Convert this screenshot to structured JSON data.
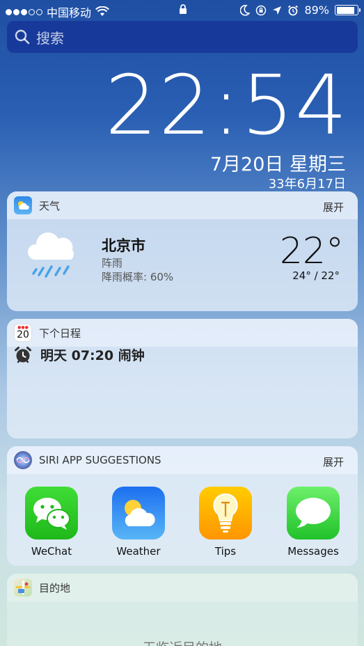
{
  "status_bar": {
    "carrier": "中国移动",
    "battery_percent": "89%",
    "battery_level": 0.89
  },
  "search": {
    "placeholder": "搜索"
  },
  "clock": {
    "time": "22:54",
    "date": "7月20日 星期三",
    "lunar_date": "33年6月17日"
  },
  "weather_widget": {
    "title": "天气",
    "expand": "展开",
    "city": "北京市",
    "condition": "阵雨",
    "rain_chance": "降雨概率: 60%",
    "temperature": "22°",
    "range": "24° / 22°"
  },
  "calendar_widget": {
    "title": "下个日程",
    "icon_day": "20",
    "event": "明天 07:20 闹钟"
  },
  "siri_widget": {
    "title": "SIRI APP SUGGESTIONS",
    "expand": "展开",
    "apps": [
      {
        "label": "WeChat"
      },
      {
        "label": "Weather"
      },
      {
        "label": "Tips"
      },
      {
        "label": "Messages"
      }
    ]
  },
  "destination_widget": {
    "title": "目的地",
    "placeholder": "无临近目的地"
  }
}
